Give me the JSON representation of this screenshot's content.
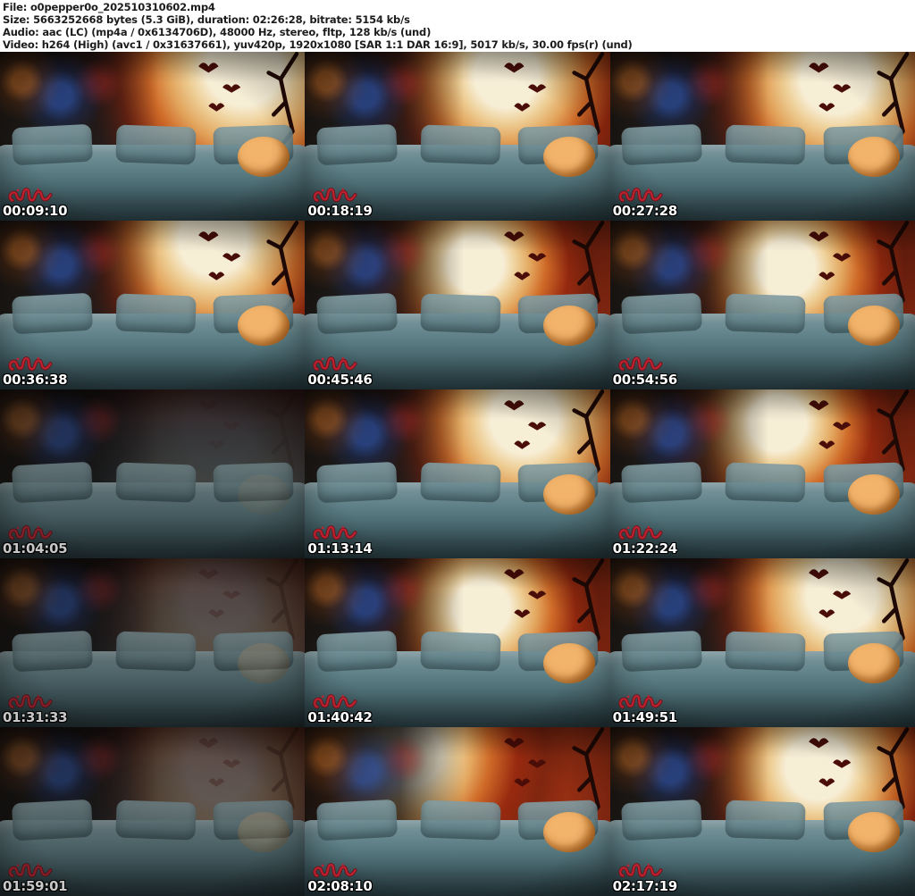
{
  "header": {
    "lines": [
      "File: o0pepper0o_202510310602.mp4",
      "Size: 5663252668 bytes (5.3 GiB), duration: 02:26:28, bitrate: 5154 kb/s",
      "Audio: aac (LC) (mp4a / 0x6134706D), 48000 Hz, stereo, fltp, 128 kb/s (und)",
      "Video: h264 (High) (avc1 / 0x31637661), yuv420p, 1920x1080 [SAR 1:1 DAR 16:9], 5017 kb/s, 30.00 fps(r) (und)"
    ]
  },
  "colors": {
    "header_text": "#1c1c1c",
    "timestamp_text": "#ffffff",
    "timestamp_outline": "#000000",
    "watermark_red": "#c81e2e",
    "moon_core": "#f7eed6",
    "moon_rim": "#cf6a28",
    "backdrop_red": "#9c3012",
    "couch_teal": "#5d7f86",
    "room_blue_glow": "#2e55b0",
    "plush_orange": "#e89a4a"
  },
  "thumbnails": [
    {
      "timestamp": "00:09:10"
    },
    {
      "timestamp": "00:18:19"
    },
    {
      "timestamp": "00:27:28"
    },
    {
      "timestamp": "00:36:38"
    },
    {
      "timestamp": "00:45:46"
    },
    {
      "timestamp": "00:54:56"
    },
    {
      "timestamp": "01:04:05"
    },
    {
      "timestamp": "01:13:14"
    },
    {
      "timestamp": "01:22:24"
    },
    {
      "timestamp": "01:31:33"
    },
    {
      "timestamp": "01:40:42"
    },
    {
      "timestamp": "01:49:51"
    },
    {
      "timestamp": "01:59:01"
    },
    {
      "timestamp": "02:08:10"
    },
    {
      "timestamp": "02:17:19"
    }
  ]
}
